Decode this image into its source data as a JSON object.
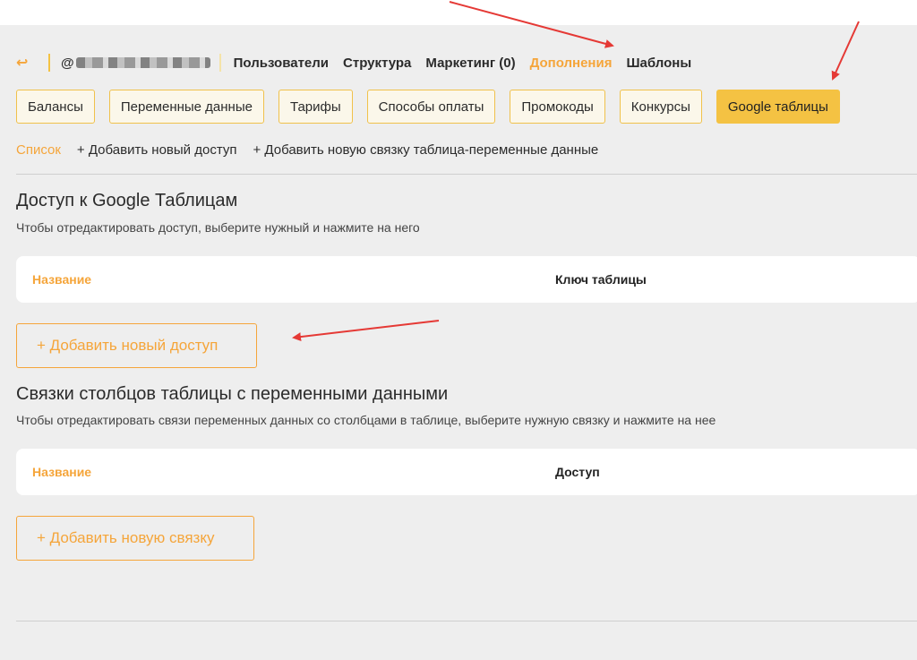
{
  "topnav": {
    "back_icon": "back-arrow-icon",
    "project_prefix": "@",
    "links": [
      {
        "label": "Пользователи"
      },
      {
        "label": "Структура"
      },
      {
        "label": "Маркетинг (0)"
      },
      {
        "label": "Дополнения",
        "active": true
      },
      {
        "label": "Шаблоны"
      }
    ]
  },
  "tabs": [
    {
      "label": "Балансы"
    },
    {
      "label": "Переменные данные"
    },
    {
      "label": "Тарифы"
    },
    {
      "label": "Способы оплаты"
    },
    {
      "label": "Промокоды"
    },
    {
      "label": "Конкурсы"
    },
    {
      "label": "Google таблицы",
      "active": true
    }
  ],
  "subnav": {
    "list": "Список",
    "add_access": "+ Добавить новый доступ",
    "add_link": "+ Добавить новую связку таблица-переменные данные"
  },
  "access_section": {
    "title": "Доступ к Google Таблицам",
    "subtitle": "Чтобы отредактировать доступ, выберите нужный и нажмите на него",
    "col_name": "Название",
    "col_key": "Ключ таблицы",
    "add_button": "+ Добавить новый доступ"
  },
  "links_section": {
    "title": "Связки столбцов таблицы с переменными данными",
    "subtitle": "Чтобы отредактировать связи переменных данных со столбцами в таблице, выберите нужную связку и нажмите на нее",
    "col_name": "Название",
    "col_access": "Доступ",
    "add_button": "+ Добавить новую связку"
  },
  "colors": {
    "accent": "#f5a53a",
    "tab_active": "#f4c243",
    "background": "#eeeeee",
    "annotation_arrow": "#e53935"
  }
}
